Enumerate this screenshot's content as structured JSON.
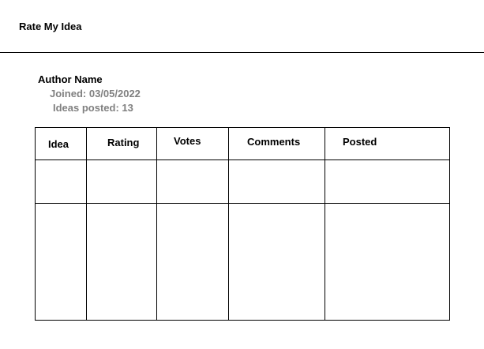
{
  "app": {
    "title": "Rate My Idea"
  },
  "author": {
    "name": "Author Name",
    "joined": "Joined: 03/05/2022",
    "ideas_posted": "Ideas posted: 13"
  },
  "table": {
    "columns": [
      "Idea",
      "Rating",
      "Votes",
      "Comments",
      "Posted"
    ],
    "rows": [
      [
        "",
        "",
        "",
        "",
        ""
      ],
      [
        "",
        "",
        "",
        "",
        ""
      ]
    ]
  }
}
